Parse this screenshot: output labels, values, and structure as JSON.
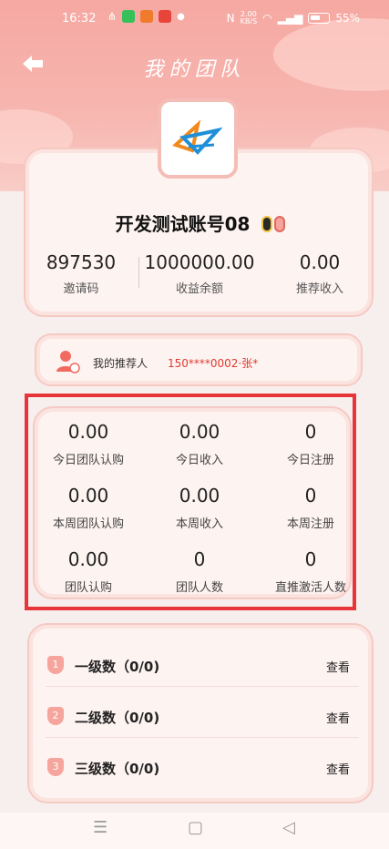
{
  "status_bar": {
    "time": "16:32",
    "net_speed_top": "2.00",
    "net_speed_bottom": "KB/S",
    "battery": "55%"
  },
  "header": {
    "title": "我的团队",
    "back_icon": "arrow-left-icon"
  },
  "profile": {
    "account_name": "开发测试账号08",
    "stats": [
      {
        "value": "897530",
        "label": "邀请码"
      },
      {
        "value": "1000000.00",
        "label": "收益余额"
      },
      {
        "value": "0.00",
        "label": "推荐收入"
      }
    ]
  },
  "referrer": {
    "label": "我的推荐人",
    "value": "150****0002·张*"
  },
  "team_stats": [
    {
      "value": "0.00",
      "label": "今日团队认购"
    },
    {
      "value": "0.00",
      "label": "今日收入"
    },
    {
      "value": "0",
      "label": "今日注册"
    },
    {
      "value": "0.00",
      "label": "本周团队认购"
    },
    {
      "value": "0.00",
      "label": "本周收入"
    },
    {
      "value": "0",
      "label": "本周注册"
    },
    {
      "value": "0.00",
      "label": "团队认购"
    },
    {
      "value": "0",
      "label": "团队人数"
    },
    {
      "value": "0",
      "label": "直推激活人数"
    }
  ],
  "levels": [
    {
      "badge": "1",
      "label": "一级数（0/0)",
      "action": "查看"
    },
    {
      "badge": "2",
      "label": "二级数（0/0)",
      "action": "查看"
    },
    {
      "badge": "3",
      "label": "三级数（0/0)",
      "action": "查看"
    }
  ],
  "colors": {
    "accent_red": "#e03a2e",
    "hero_pink": "#f6a8a2",
    "card_border": "#f6c9c3",
    "highlight_box": "#e8353a"
  }
}
